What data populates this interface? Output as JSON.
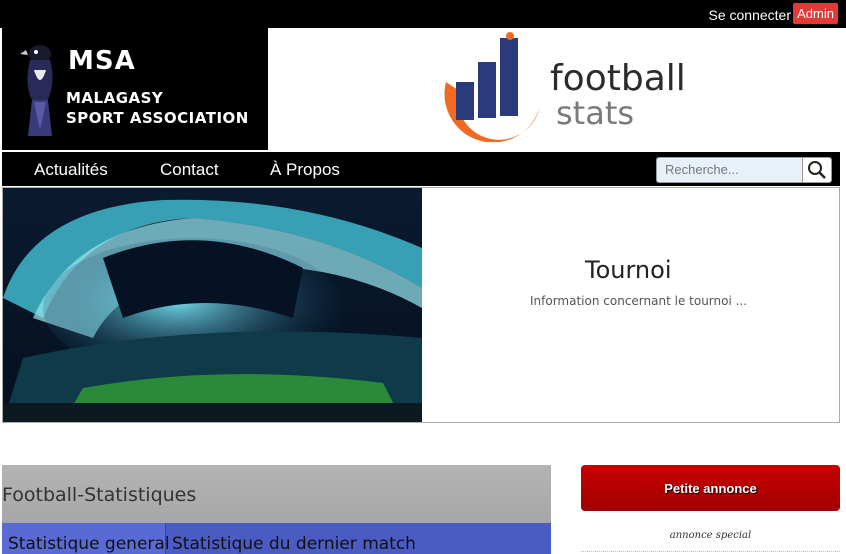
{
  "topbar": {
    "login_label": "Se connecter",
    "admin_label": "Admin"
  },
  "logo": {
    "msa": "MSA",
    "line1": "MALAGASY",
    "line2": "SPORT ASSOCIATION"
  },
  "brand": {
    "word1": "football",
    "word2": "stats"
  },
  "nav": {
    "items": [
      "Actualités",
      "Contact",
      "À Propos"
    ]
  },
  "search": {
    "placeholder": "Recherche..."
  },
  "hero": {
    "title": "Tournoi",
    "info": "Information concernant le tournoi ..."
  },
  "stats_panel": {
    "title": "Football-Statistiques",
    "tabs": [
      "Statistique general",
      "Statistique du dernier match"
    ]
  },
  "sidebar": {
    "ad_button": "Petite annonce",
    "ad_note": "annonce special"
  }
}
